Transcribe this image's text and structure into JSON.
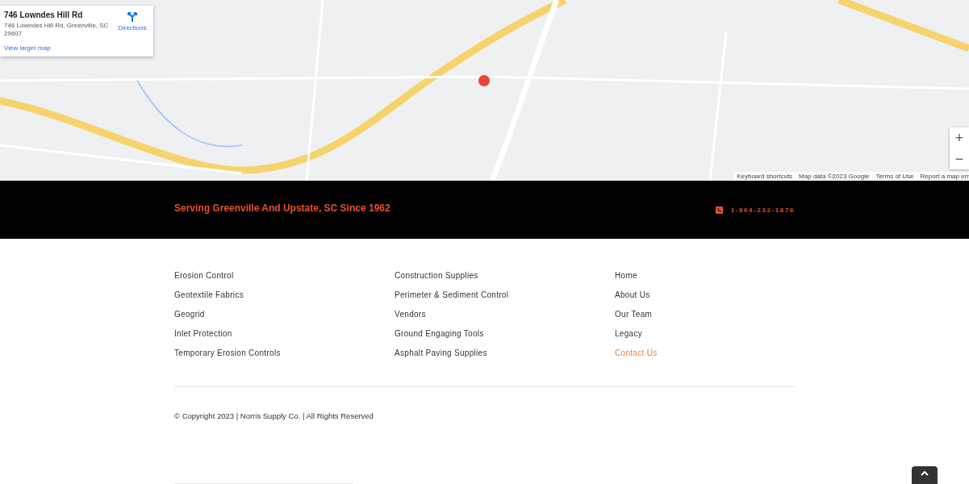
{
  "map": {
    "card": {
      "title": "746 Lowndes Hill Rd",
      "address": "746 Lowndes Hill Rd, Greenville, SC 29607",
      "directions": "Directions",
      "larger_map": "View larger map"
    },
    "zoom_in": "+",
    "zoom_out": "−",
    "attribution": [
      "Keyboard shortcuts",
      "Map data ©2023 Google",
      "Terms of Use",
      "Report a map err"
    ]
  },
  "banner": {
    "tagline": "Serving Greenville And Upstate, SC Since 1962",
    "phone": "1-864-232-1876"
  },
  "footer_columns": [
    [
      {
        "label": "Erosion Control",
        "selected": false
      },
      {
        "label": "Geotextile Fabrics",
        "selected": false
      },
      {
        "label": "Geogrid",
        "selected": false
      },
      {
        "label": "Inlet Protection",
        "selected": false
      },
      {
        "label": "Temporary Erosion Controls",
        "selected": false
      }
    ],
    [
      {
        "label": "Construction Supplies",
        "selected": false
      },
      {
        "label": "Perimeter & Sediment Control",
        "selected": false
      },
      {
        "label": "Vendors",
        "selected": false
      },
      {
        "label": "Ground Engaging Tools",
        "selected": false
      },
      {
        "label": "Asphalt Paving Supplies",
        "selected": false
      }
    ],
    [
      {
        "label": "Home",
        "selected": false
      },
      {
        "label": "About Us",
        "selected": false
      },
      {
        "label": "Our Team",
        "selected": false
      },
      {
        "label": "Legacy",
        "selected": false
      },
      {
        "label": "Contact Us",
        "selected": true
      }
    ]
  ],
  "copyright": "© Copyright 2023 | Norris Supply Co. | All Rights Reserved"
}
